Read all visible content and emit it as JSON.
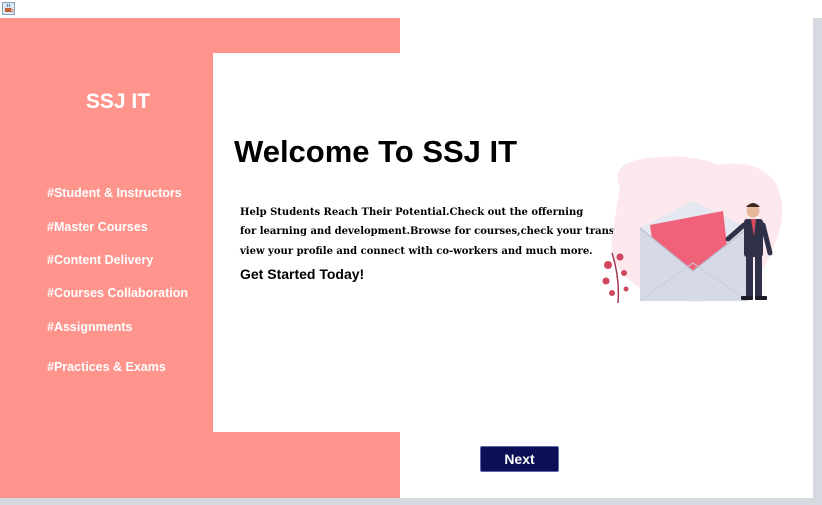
{
  "window": {
    "icon": "java-cup-icon"
  },
  "sidebar": {
    "brand": "SSJ IT",
    "features": [
      "#Student & Instructors",
      "#Master Courses",
      "#Content Delivery",
      "#Courses Collaboration",
      "#Assignments",
      "#Practices & Exams"
    ]
  },
  "main": {
    "heading": "Welcome To SSJ IT",
    "description": [
      "Help Students Reach Their Potential.Check out the offerning",
      "for learning and development.Browse for courses,check your transcript,",
      "view your profile and connect with co-workers and much more."
    ],
    "cta": "Get Started Today!",
    "illustration": "envelope-businessman-illustration",
    "next_label": "Next"
  },
  "colors": {
    "sidebar": "#ff948c",
    "button": "#0c0f55",
    "window_border": "#d6d9df"
  }
}
